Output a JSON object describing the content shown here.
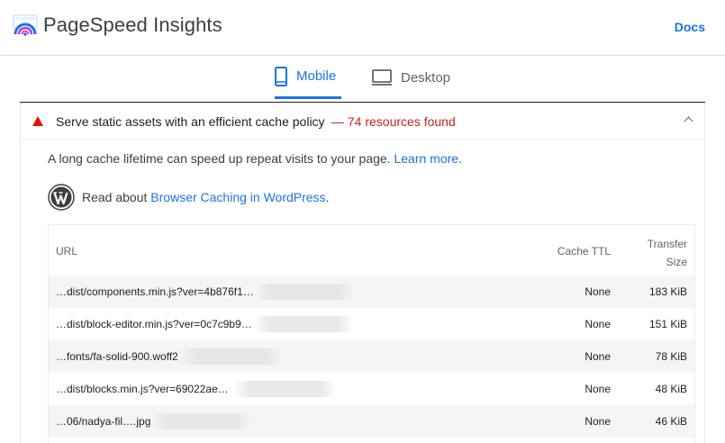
{
  "header": {
    "app_title": "PageSpeed Insights",
    "docs_label": "Docs"
  },
  "tabs": [
    {
      "label": "Mobile",
      "active": true
    },
    {
      "label": "Desktop",
      "active": false
    }
  ],
  "audit": {
    "severity": "warning",
    "title": "Serve static assets with an efficient cache policy",
    "display_value": "— 74 resources found",
    "description": "A long cache lifetime can speed up repeat visits to your page.",
    "learn_more": "Learn more",
    "wp_prefix": "Read about",
    "wp_link": "Browser Caching in WordPress"
  },
  "table": {
    "headers": {
      "url": "URL",
      "cache_ttl": "Cache TTL",
      "transfer_size_line1": "Transfer",
      "transfer_size_line2": "Size"
    },
    "rows": [
      {
        "url": "…dist/components.min.js?ver=4b876f1…",
        "ttl": "None",
        "size": "183 KiB"
      },
      {
        "url": "…dist/block-editor.min.js?ver=0c7c9b9…",
        "ttl": "None",
        "size": "151 KiB"
      },
      {
        "url": "…fonts/fa-solid-900.woff2",
        "ttl": "None",
        "size": "78 KiB"
      },
      {
        "url": "…dist/blocks.min.js?ver=69022ae…",
        "ttl": "None",
        "size": "48 KiB"
      },
      {
        "url": "…06/nadya-fil….jpg",
        "ttl": "None",
        "size": "46 KiB"
      }
    ]
  },
  "colors": {
    "accent": "#1a73e8",
    "warning": "#eb0f00",
    "warning_text": "#c5221f"
  }
}
